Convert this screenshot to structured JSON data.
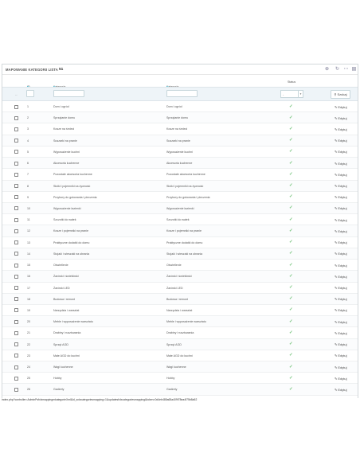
{
  "panel": {
    "title": "MAPOWANIE KATEGORII LISTA",
    "count": "51"
  },
  "table": {
    "headers": {
      "id": "ID",
      "xml": "Kategoria XML",
      "shop": "Kategoria sklepu",
      "status": "Status"
    },
    "filter": {
      "dash": "--",
      "status_value": "-",
      "search_label": "Szukaj"
    },
    "edit_label": "Edytuj",
    "rows": [
      {
        "id": "1",
        "xml": "Dom i ogród",
        "shop": "Dom i ogród"
      },
      {
        "id": "2",
        "xml": "Sprzątanie domu",
        "shop": "Sprzątanie domu"
      },
      {
        "id": "3",
        "xml": "Kosze na śmieci",
        "shop": "Kosze na śmieci"
      },
      {
        "id": "4",
        "xml": "Suszarki na pranie",
        "shop": "Suszarki na pranie"
      },
      {
        "id": "5",
        "xml": "Wyposażenie kuchni",
        "shop": "Wyposażenie kuchni"
      },
      {
        "id": "6",
        "xml": "Akcesoria kuchenne",
        "shop": "Akcesoria kuchenne"
      },
      {
        "id": "7",
        "xml": "Pozostałe akcesoria kuchenne",
        "shop": "Pozostałe akcesoria kuchenne"
      },
      {
        "id": "8",
        "xml": "Słoiki i pojemniki na żywność",
        "shop": "Słoiki i pojemniki na żywność"
      },
      {
        "id": "9",
        "xml": "Przybory do gotowania i pieczenia",
        "shop": "Przybory do gotowania i pieczenia"
      },
      {
        "id": "10",
        "xml": "Wyposażenie łazienki",
        "shop": "Wyposażenie łazienki"
      },
      {
        "id": "11",
        "xml": "Szczotki do wałek",
        "shop": "Szczotki do wałek"
      },
      {
        "id": "12",
        "xml": "Kosze i pojemniki na pranie",
        "shop": "Kosze i pojemniki na pranie"
      },
      {
        "id": "13",
        "xml": "Praktyczne dodatki do domu",
        "shop": "Praktyczne dodatki do domu"
      },
      {
        "id": "14",
        "xml": "Stojaki i wieszaki na ubrania",
        "shop": "Stojaki i wieszaki na ubrania"
      },
      {
        "id": "15",
        "xml": "Oświetlenie",
        "shop": "Oświetlenie"
      },
      {
        "id": "16",
        "xml": "Żarówki i świetlówki",
        "shop": "Żarówki i świetlówki"
      },
      {
        "id": "17",
        "xml": "Żarówki LED",
        "shop": "Żarówki LED"
      },
      {
        "id": "18",
        "xml": "Budowa i remont",
        "shop": "Budowa i remont"
      },
      {
        "id": "19",
        "xml": "Narzędzia i warsztat",
        "shop": "Narzędzia i warsztat"
      },
      {
        "id": "20",
        "xml": "Meble i wyposażenie warsztatu",
        "shop": "Meble i wyposażenie warsztatu"
      },
      {
        "id": "21",
        "xml": "Drabiny i rusztowania",
        "shop": "Drabiny i rusztowania"
      },
      {
        "id": "22",
        "xml": "Sprzęt AGD",
        "shop": "Sprzęt AGD"
      },
      {
        "id": "23",
        "xml": "Małe AGD do kuchni",
        "shop": "Małe AGD do kuchni"
      },
      {
        "id": "24",
        "xml": "Wagi kuchenne",
        "shop": "Wagi kuchenne"
      },
      {
        "id": "25",
        "xml": "Hobby",
        "shop": "Hobby"
      },
      {
        "id": "26",
        "xml": "Gadżety",
        "shop": "Gadżety"
      }
    ]
  },
  "statusbar": {
    "url": "index.php?controller=AdminPsfxlxmappingmkategorieXml&id_sxlvcategoriesmapping=1&updatesfxlxcategoriesmapping&token=0d4eb485a65a409f78ea4f75b8a52"
  },
  "colors": {
    "accent": "#25b9d7",
    "status_ok": "#72c279"
  }
}
